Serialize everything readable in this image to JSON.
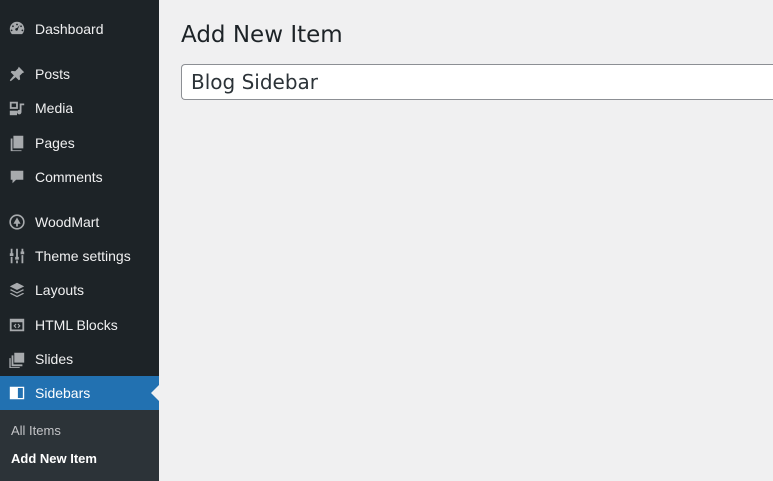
{
  "sidebar": {
    "items": [
      {
        "label": "Dashboard",
        "icon": "dashboard-icon"
      },
      {
        "label": "Posts",
        "icon": "pin-icon"
      },
      {
        "label": "Media",
        "icon": "media-icon"
      },
      {
        "label": "Pages",
        "icon": "pages-icon"
      },
      {
        "label": "Comments",
        "icon": "comment-icon"
      },
      {
        "label": "WoodMart",
        "icon": "woodmart-icon"
      },
      {
        "label": "Theme settings",
        "icon": "sliders-icon"
      },
      {
        "label": "Layouts",
        "icon": "layers-icon"
      },
      {
        "label": "HTML Blocks",
        "icon": "code-block-icon"
      },
      {
        "label": "Slides",
        "icon": "slides-icon"
      },
      {
        "label": "Sidebars",
        "icon": "sidebar-icon",
        "active": true
      }
    ],
    "submenu": [
      {
        "label": "All Items"
      },
      {
        "label": "Add New Item",
        "current": true
      }
    ],
    "colors": {
      "background": "#1d2327",
      "active": "#2271b1",
      "submenu_bg": "#2c3338"
    }
  },
  "main": {
    "title": "Add New Item",
    "title_input": {
      "value": "Blog Sidebar",
      "placeholder": ""
    }
  }
}
